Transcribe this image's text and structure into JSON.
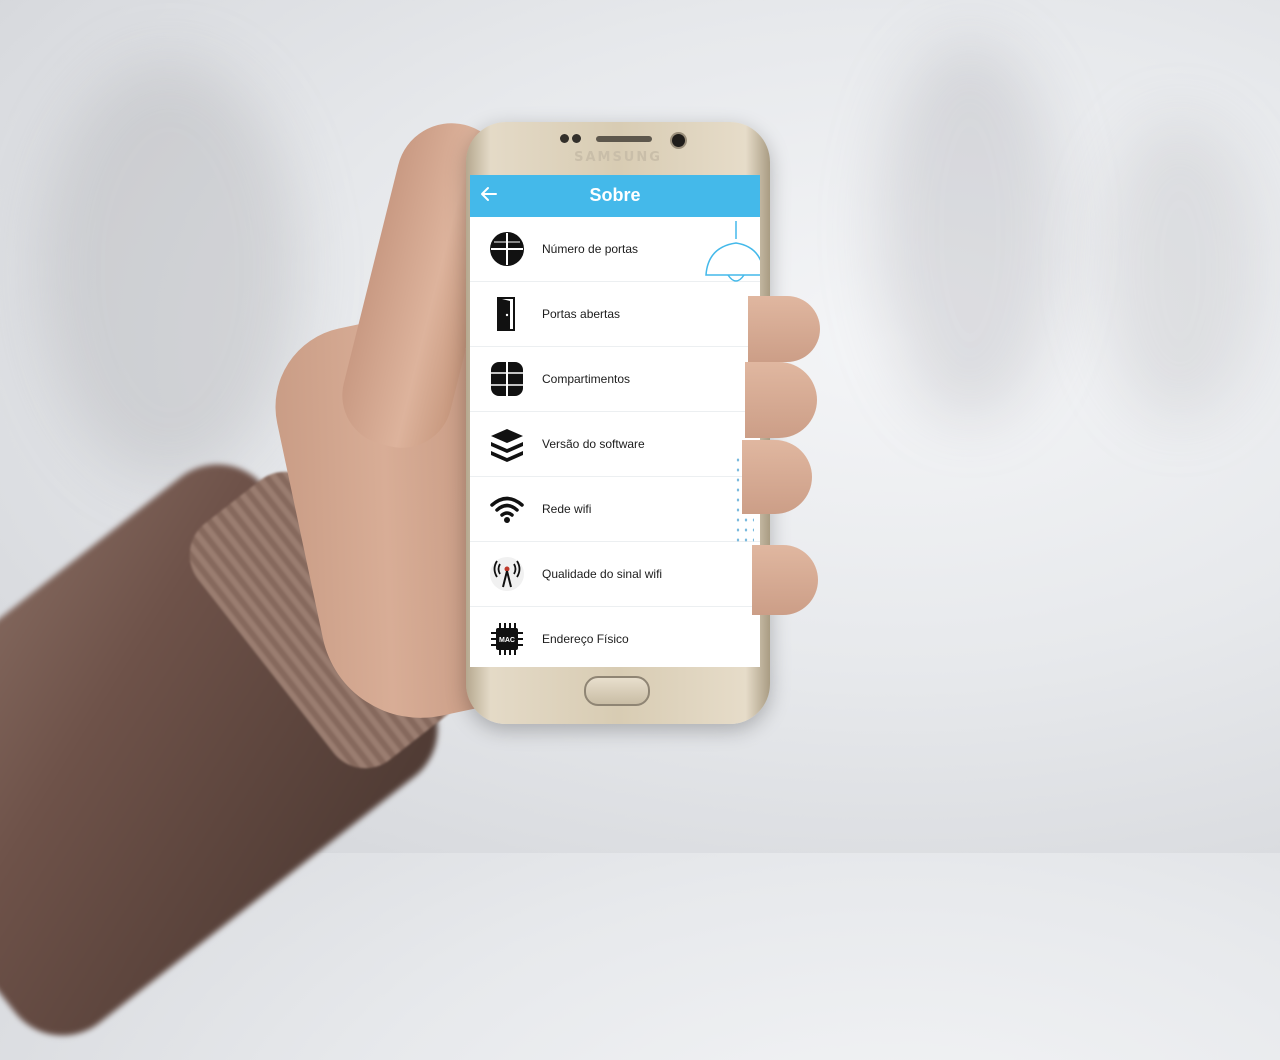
{
  "device": {
    "brand": "SAMSUNG"
  },
  "app": {
    "title": "Sobre",
    "back_icon": "arrow-left-icon",
    "accent_color": "#44b9ea"
  },
  "items": [
    {
      "label": "Número de portas",
      "icon": "grid-door-icon"
    },
    {
      "label": "Portas abertas",
      "icon": "open-door-icon"
    },
    {
      "label": "Compartimentos",
      "icon": "compartments-icon"
    },
    {
      "label": "Versão do software",
      "icon": "layers-icon"
    },
    {
      "label": "Rede wifi",
      "icon": "wifi-icon"
    },
    {
      "label": "Qualidade do sinal wifi",
      "icon": "signal-tower-icon"
    },
    {
      "label": "Endereço Físico",
      "icon": "mac-chip-icon"
    }
  ],
  "chip_text": "MAC"
}
